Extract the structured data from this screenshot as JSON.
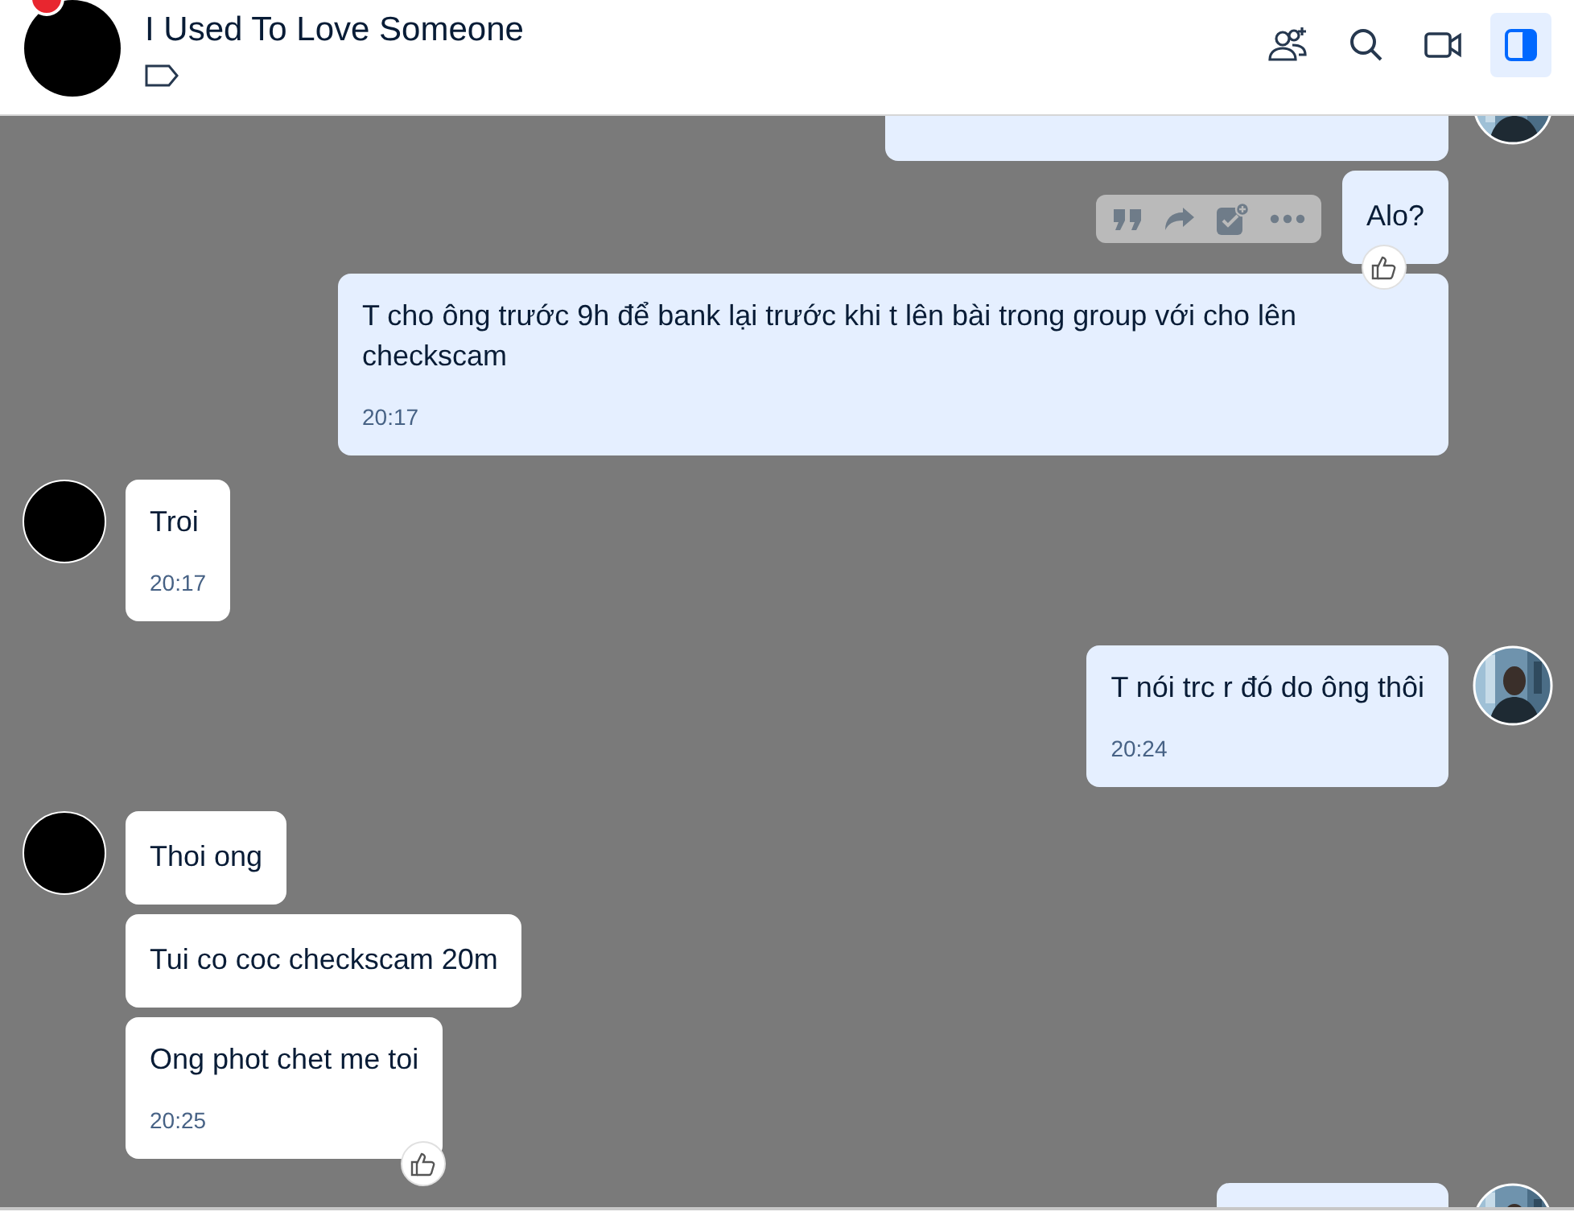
{
  "conversation": {
    "title": "I Used To Love Someone",
    "unread_badge": true
  },
  "header_actions": [
    {
      "kind": "add-member",
      "selected": false
    },
    {
      "kind": "search",
      "selected": false
    },
    {
      "kind": "video-call",
      "selected": false
    },
    {
      "kind": "sidebar",
      "selected": true
    }
  ],
  "messages": [
    {
      "outgoing": true,
      "kind": "clipped-top",
      "avatar": true,
      "react_button": false,
      "hover_actions": false
    },
    {
      "outgoing": true,
      "kind": "text",
      "text": "Alo?",
      "avatar": false,
      "react_button": true,
      "hover_actions": true
    },
    {
      "outgoing": true,
      "kind": "text",
      "text": "T cho ông trước 9h để bank lại trước khi t lên bài trong group với cho lên checkscam",
      "time": "20:17",
      "avatar": false,
      "react_button": false,
      "hover_actions": false
    },
    {
      "outgoing": false,
      "kind": "text",
      "text": "Troi",
      "time": "20:17",
      "avatar": true,
      "react_button": false,
      "hover_actions": false
    },
    {
      "outgoing": true,
      "kind": "text",
      "text": "T nói trc r đó do ông thôi",
      "time": "20:24",
      "avatar": true,
      "react_button": false,
      "hover_actions": false
    },
    {
      "outgoing": false,
      "kind": "text",
      "text": "Thoi ong",
      "avatar": true,
      "react_button": false,
      "hover_actions": false
    },
    {
      "outgoing": false,
      "kind": "text",
      "text": "Tui co coc checkscam 20m",
      "avatar": false,
      "react_button": false,
      "hover_actions": false
    },
    {
      "outgoing": false,
      "kind": "text",
      "text": "Ong phot chet me toi",
      "time": "20:25",
      "avatar": false,
      "react_button": true,
      "hover_actions": false
    },
    {
      "outgoing": true,
      "kind": "clipped-bottom",
      "avatar": true,
      "react_button": false,
      "hover_actions": false
    }
  ]
}
